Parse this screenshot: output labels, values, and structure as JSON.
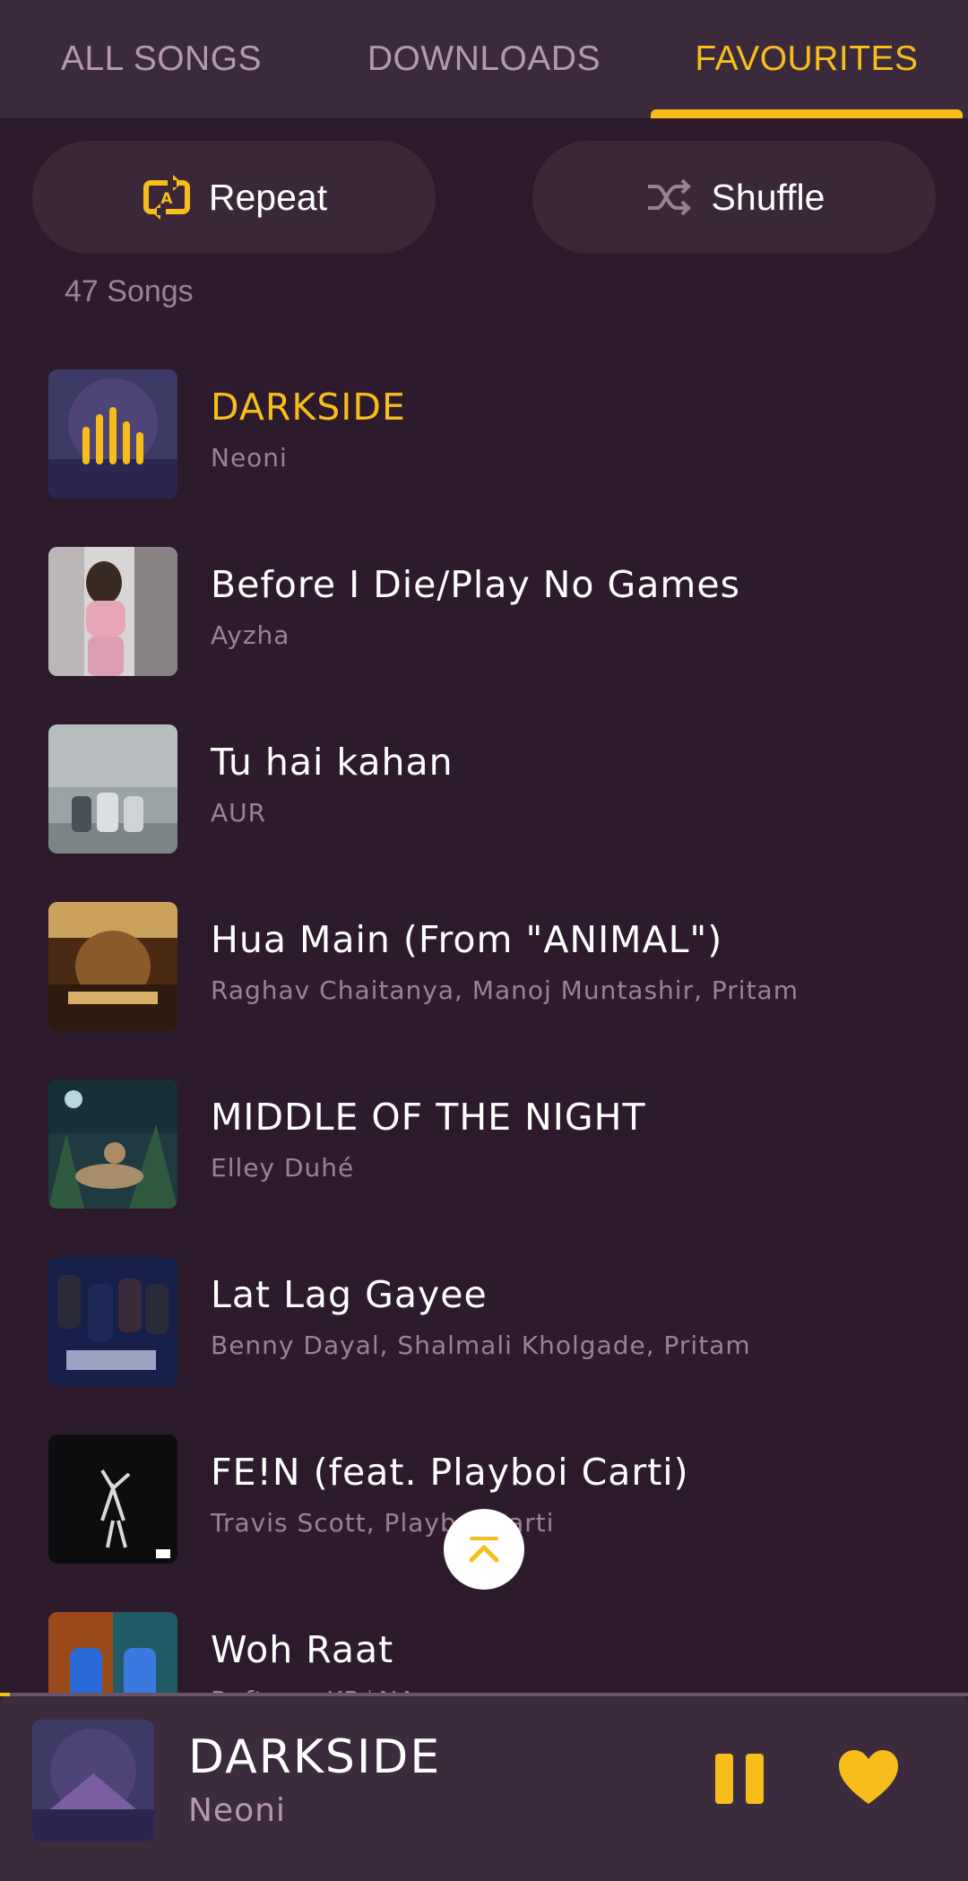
{
  "tabs": [
    {
      "label": "ALL SONGS",
      "active": false
    },
    {
      "label": "DOWNLOADS",
      "active": false
    },
    {
      "label": "FAVOURITES",
      "active": true
    }
  ],
  "actions": {
    "repeat_label": "Repeat",
    "repeat_icon": "repeat-a-icon",
    "shuffle_label": "Shuffle",
    "shuffle_icon": "shuffle-icon"
  },
  "song_count": "47 Songs",
  "songs": [
    {
      "title": "DARKSIDE",
      "artist": "Neoni",
      "playing": true
    },
    {
      "title": "Before I Die/Play No Games",
      "artist": "Ayzha",
      "playing": false
    },
    {
      "title": "Tu hai kahan",
      "artist": "AUR",
      "playing": false
    },
    {
      "title": "Hua Main (From \"ANIMAL\")",
      "artist": "Raghav Chaitanya, Manoj Muntashir, Pritam",
      "playing": false
    },
    {
      "title": "MIDDLE OF THE NIGHT",
      "artist": "Elley Duhé",
      "playing": false
    },
    {
      "title": "Lat Lag Gayee",
      "artist": "Benny Dayal, Shalmali Kholgade, Pritam",
      "playing": false
    },
    {
      "title": "FE!N (feat. Playboi Carti)",
      "artist": "Travis Scott, Playboi Carti",
      "playing": false
    },
    {
      "title": "Woh Raat",
      "artist": "Raftaar, KR$NA",
      "playing": false
    }
  ],
  "now_playing": {
    "title": "DARKSIDE",
    "artist": "Neoni",
    "progress": 0.01,
    "favourite": true
  },
  "colors": {
    "accent": "#f6bd1b",
    "background": "#2d1b2d",
    "surface": "#3b2a3c",
    "muted_text": "#9c8196"
  }
}
